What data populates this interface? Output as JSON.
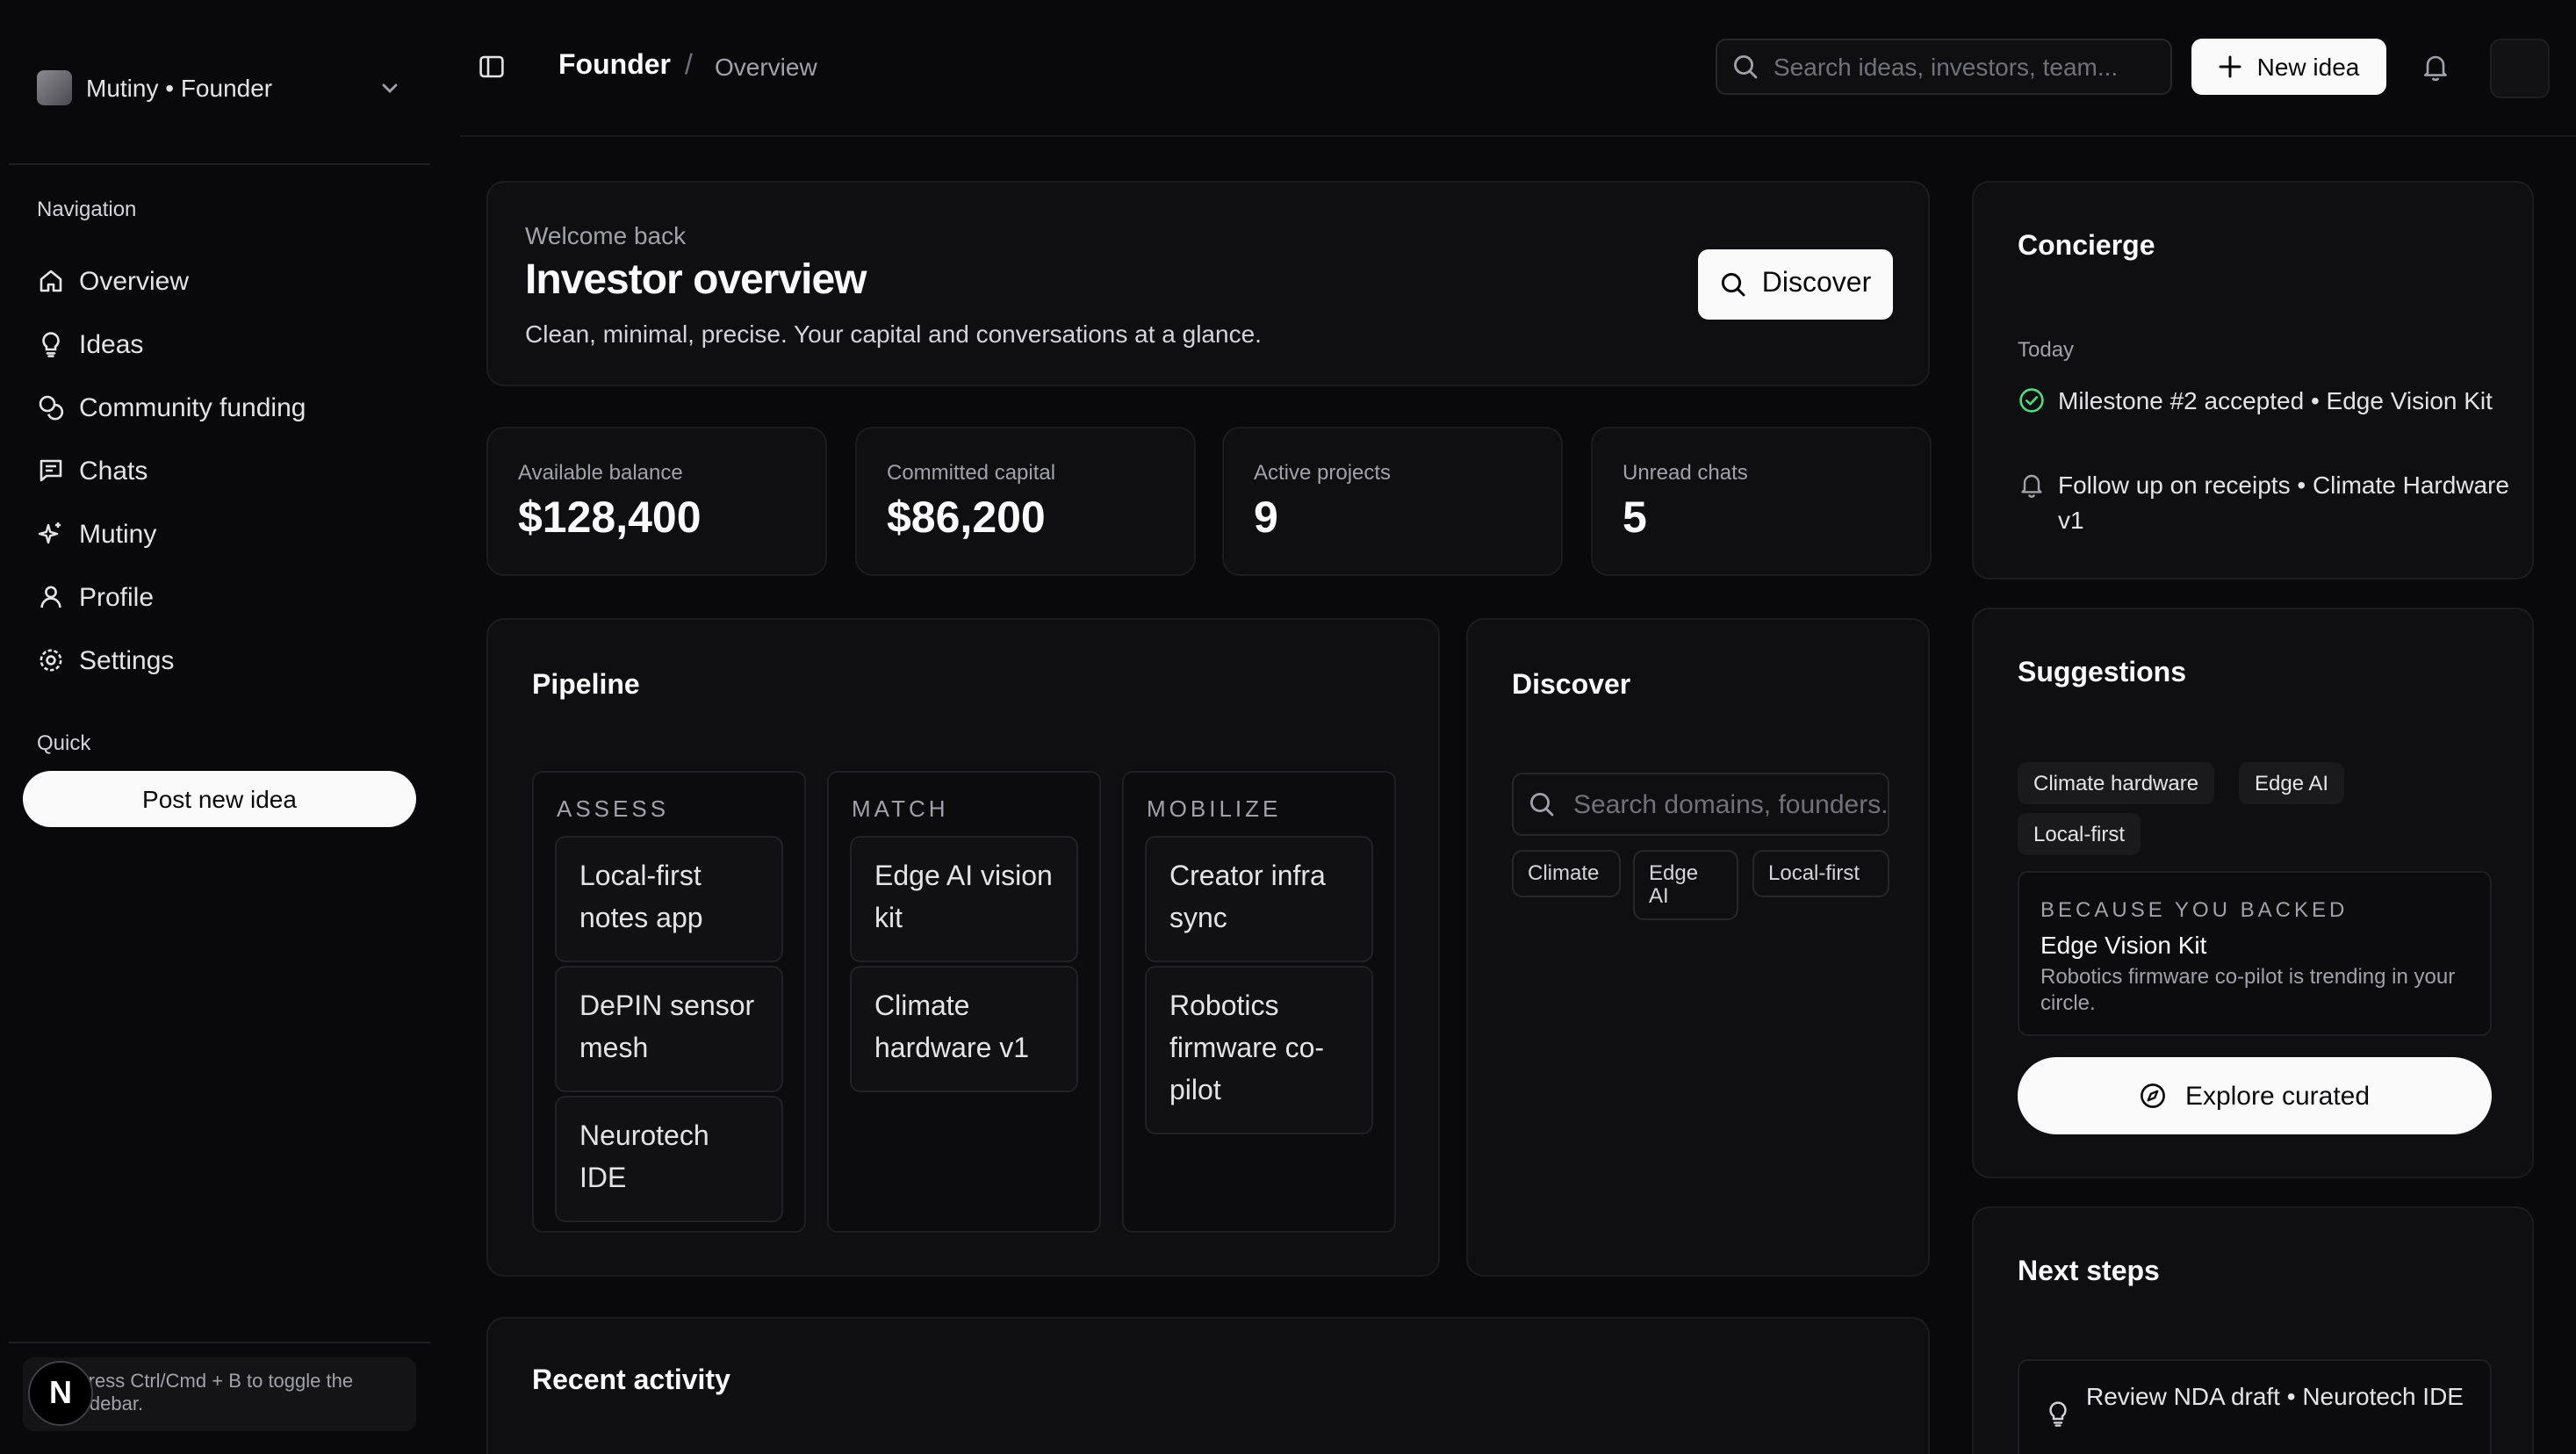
{
  "workspace": {
    "name": "Mutiny • Founder"
  },
  "sidebar": {
    "navigation_label": "Navigation",
    "items": [
      {
        "label": "Overview",
        "icon": "home-icon"
      },
      {
        "label": "Ideas",
        "icon": "lightbulb-icon"
      },
      {
        "label": "Community funding",
        "icon": "coins-icon"
      },
      {
        "label": "Chats",
        "icon": "message-icon"
      },
      {
        "label": "Mutiny",
        "icon": "sparkles-icon"
      },
      {
        "label": "Profile",
        "icon": "user-icon"
      },
      {
        "label": "Settings",
        "icon": "gear-icon"
      }
    ],
    "quick_label": "Quick",
    "post_button": "Post new idea",
    "hint": "Press Ctrl/Cmd + B to toggle the sidebar.",
    "badge": "N"
  },
  "header": {
    "breadcrumb_root": "Founder",
    "breadcrumb_sep": "/",
    "breadcrumb_page": "Overview",
    "search_placeholder": "Search ideas, investors, team...",
    "new_button": "New idea"
  },
  "welcome": {
    "eyebrow": "Welcome back",
    "title": "Investor overview",
    "subtitle": "Clean, minimal, precise. Your capital and conversations at a glance.",
    "discover_button": "Discover"
  },
  "stats": [
    {
      "label": "Available balance",
      "value": "$128,400"
    },
    {
      "label": "Committed capital",
      "value": "$86,200"
    },
    {
      "label": "Active projects",
      "value": "9"
    },
    {
      "label": "Unread chats",
      "value": "5"
    }
  ],
  "pipeline": {
    "title": "Pipeline",
    "columns": [
      {
        "name": "ASSESS",
        "cards": [
          "Local-first notes app",
          "DePIN sensor mesh",
          "Neurotech IDE"
        ]
      },
      {
        "name": "MATCH",
        "cards": [
          "Edge AI vision kit",
          "Climate hardware v1"
        ]
      },
      {
        "name": "MOBILIZE",
        "cards": [
          "Creator infra sync",
          "Robotics firmware co-pilot"
        ]
      }
    ]
  },
  "discover": {
    "title": "Discover",
    "search_placeholder": "Search domains, founders...",
    "tags": [
      "Climate",
      "Edge AI",
      "Local-first"
    ]
  },
  "recent": {
    "title": "Recent activity"
  },
  "concierge": {
    "title": "Concierge",
    "day": "Today",
    "items": [
      {
        "text": "Milestone #2 accepted • Edge Vision Kit",
        "icon": "check-circle-icon"
      },
      {
        "text": "Follow up on receipts • Climate Hardware v1",
        "icon": "bell-icon"
      }
    ]
  },
  "suggestions": {
    "title": "Suggestions",
    "tags": [
      "Climate hardware",
      "Edge AI",
      "Local-first"
    ],
    "because_label": "BECAUSE YOU BACKED",
    "because_title": "Edge Vision Kit",
    "because_desc": "Robotics firmware co-pilot is trending in your circle.",
    "explore_button": "Explore curated"
  },
  "next_steps": {
    "title": "Next steps",
    "items": [
      {
        "text": "Review NDA draft • Neurotech IDE",
        "icon": "lightbulb-icon"
      }
    ]
  }
}
